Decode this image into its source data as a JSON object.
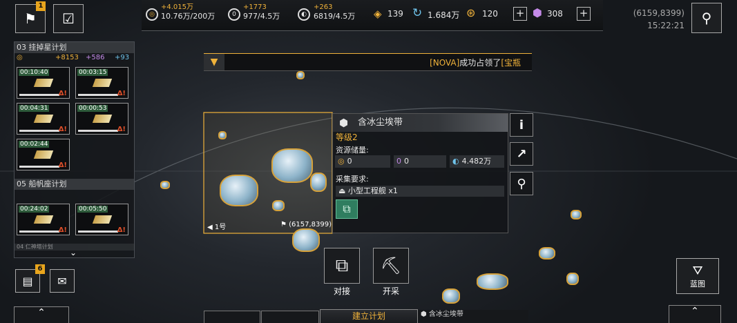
{
  "top_left": {
    "alert_badge": "1"
  },
  "resources": {
    "gold": {
      "delta": "+4.015万",
      "value": "10.76万/200万"
    },
    "purple": {
      "delta": "+1773",
      "value": "977/4.5万"
    },
    "blue": {
      "delta": "+263",
      "value": "6819/4.5万"
    },
    "triangle_count": "139",
    "crystal_count": "1.684万",
    "coin_count": "120",
    "premium_count": "308"
  },
  "coords_top": "(6159,8399)",
  "clock": "15:22:21",
  "left_panel": {
    "plan1_title": "03 挂掉星计划",
    "plan1_stats": {
      "a": "+8153",
      "b": "+586",
      "c": "+93"
    },
    "plan1_tasks": [
      "00:10:40",
      "00:03:15",
      "00:04:31",
      "00:00:53",
      "00:02:44"
    ],
    "plan2_title": "05 船帆座计划",
    "plan2_tasks": [
      "00:24:02",
      "00:05:50"
    ],
    "plan3_title": "04 仁神塔计划",
    "docs_badge": "6"
  },
  "banner": {
    "prefix": "[NOVA]",
    "text": "成功占领了",
    "suffix": "[宝瓶"
  },
  "info_panel": {
    "title": "含冰尘埃带",
    "level": "等级2",
    "storage_label": "资源储量:",
    "storage": {
      "gold": "0",
      "purple": "0",
      "blue": "4.482万"
    },
    "req_label": "采集要求:",
    "req_value": "小型工程舰 x1"
  },
  "map_labels": {
    "fleet": "1号",
    "coords": "(6157,8399)"
  },
  "actions": {
    "dock": "对接",
    "mine": "开采"
  },
  "right_panel": {
    "blueprint": "蓝图"
  },
  "bottom": {
    "build_plan": "建立计划",
    "target": "含冰尘埃带"
  },
  "colors": {
    "accent_gold": "#f0b23a",
    "panel_bg": "#16181b"
  }
}
